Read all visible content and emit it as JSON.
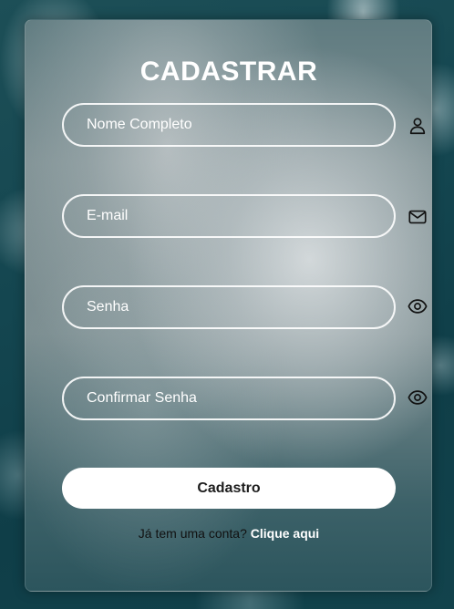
{
  "form": {
    "title": "CADASTRAR",
    "fields": [
      {
        "placeholder": "Nome Completo",
        "icon": "user-icon"
      },
      {
        "placeholder": "E-mail",
        "icon": "mail-icon"
      },
      {
        "placeholder": "Senha",
        "icon": "eye-icon"
      },
      {
        "placeholder": "Confirmar Senha",
        "icon": "eye-icon"
      }
    ],
    "submit_label": "Cadastro",
    "footer_text": "Já tem uma conta?",
    "footer_link": "Clique aqui"
  },
  "colors": {
    "text": "#ffffff",
    "button_bg": "#ffffff",
    "button_text": "#1d1d1d",
    "footer_text": "#111111"
  }
}
